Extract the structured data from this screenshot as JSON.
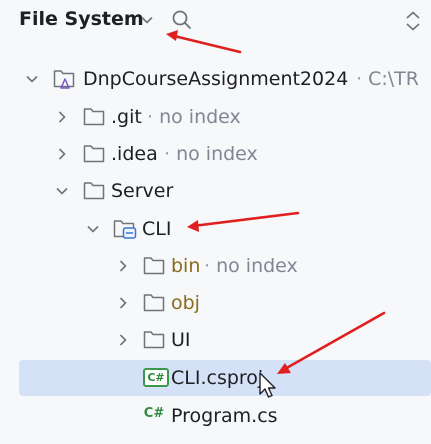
{
  "header": {
    "title": "File System",
    "icons": {
      "chevron": "chevron-down-icon",
      "search": "search-icon",
      "updown": "expand-collapse-icon"
    }
  },
  "tree": {
    "root": {
      "label": "DnpCourseAssignment2024",
      "path": "C:\\TR"
    },
    "git": {
      "label": ".git",
      "note": "no index"
    },
    "idea": {
      "label": ".idea",
      "note": "no index"
    },
    "server": {
      "label": "Server"
    },
    "cli": {
      "label": "CLI"
    },
    "bin": {
      "label": "bin",
      "note": "no index"
    },
    "obj": {
      "label": "obj"
    },
    "ui": {
      "label": "UI"
    },
    "csproj": {
      "label": "CLI.csproj",
      "badge": "C#"
    },
    "program": {
      "label": "Program.cs",
      "badge": "C#"
    }
  },
  "colors": {
    "selection": "#d5e1f7",
    "annotation_arrow": "#e02020",
    "csharp_green": "#2f8a3e",
    "muted_text": "#818594"
  }
}
